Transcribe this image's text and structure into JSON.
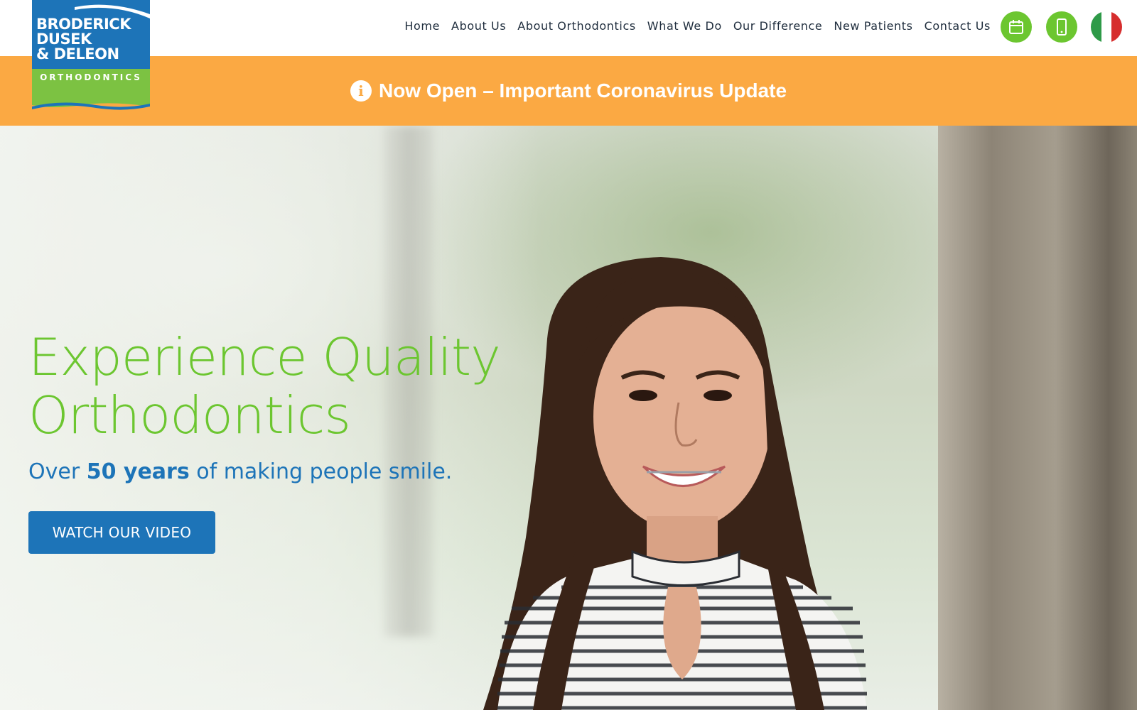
{
  "logo": {
    "line1": "BRODERICK",
    "line2": "DUSEK",
    "line3": "& DELEON",
    "subtitle": "ORTHODONTICS"
  },
  "nav": {
    "items": [
      {
        "label": "Home"
      },
      {
        "label": "About Us"
      },
      {
        "label": "About Orthodontics"
      },
      {
        "label": "What We Do"
      },
      {
        "label": "Our Difference"
      },
      {
        "label": "New Patients"
      },
      {
        "label": "Contact Us"
      }
    ],
    "icons": [
      "calendar-icon",
      "phone-icon",
      "italian-flag-icon"
    ]
  },
  "banner": {
    "text": "Now Open – Important Coronavirus Update",
    "icon": "info-icon"
  },
  "hero": {
    "title_line1": "Experience Quality",
    "title_line2": "Orthodontics",
    "subtitle_pre": "Over ",
    "subtitle_bold": "50 years",
    "subtitle_post": " of making people smile.",
    "button_label": "WATCH OUR VIDEO"
  },
  "colors": {
    "brand_blue": "#1d74b8",
    "brand_green": "#6cc630",
    "banner_orange": "#fba943",
    "nav_text": "#1f2d3d"
  }
}
